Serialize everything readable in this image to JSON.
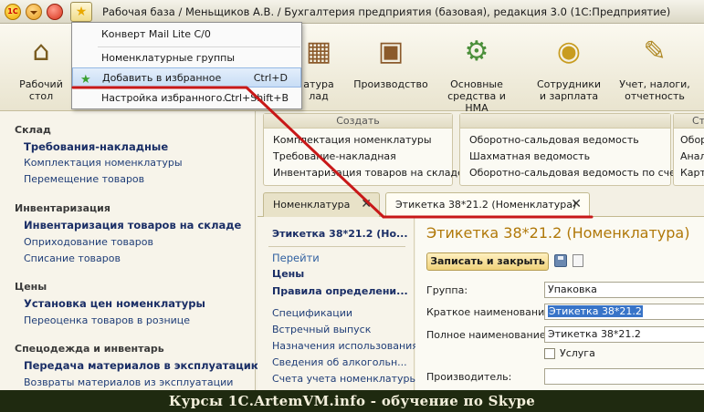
{
  "window": {
    "title": "Рабочая база / Меньщиков А.В. / Бухгалтерия предприятия (базовая), редакция 3.0  (1С:Предприятие)",
    "logo_text": "1С"
  },
  "toolbar": {
    "items": [
      {
        "label": "Рабочий стол",
        "icon": "home-icon"
      },
      {
        "label": "Номенклатура склад",
        "icon": "boxes-icon"
      },
      {
        "label": "Производство",
        "icon": "toolbox-icon"
      },
      {
        "label": "Основные средства и НМА",
        "icon": "gear-icon"
      },
      {
        "label": "Сотрудники и зарплата",
        "icon": "coins-icon"
      },
      {
        "label": "Учет, налоги, отчетность",
        "icon": "user-icon"
      }
    ],
    "partial_labels": [
      "атура",
      "лад"
    ]
  },
  "fav_menu": {
    "items": [
      {
        "label": "Конверт Mail Lite C/0",
        "shortcut": ""
      },
      {
        "label": "Номенклатурные группы",
        "shortcut": ""
      },
      {
        "label": "Добавить в избранное",
        "shortcut": "Ctrl+D",
        "highlighted": true
      },
      {
        "label": "Настройка избранного...",
        "shortcut": "Ctrl+Shift+B"
      }
    ]
  },
  "leftnav": {
    "groups": [
      {
        "title": "Склад",
        "items": [
          {
            "label": "Требования-накладные",
            "bold": true
          },
          {
            "label": "Комплектация номенклатуры"
          },
          {
            "label": "Перемещение товаров"
          }
        ]
      },
      {
        "title": "Инвентаризация",
        "items": [
          {
            "label": "Инвентаризация товаров на складе",
            "bold": true
          },
          {
            "label": "Оприходование товаров"
          },
          {
            "label": "Списание товаров"
          }
        ]
      },
      {
        "title": "Цены",
        "items": [
          {
            "label": "Установка цен номенклатуры",
            "bold": true
          },
          {
            "label": "Переоценка товаров в рознице"
          }
        ]
      },
      {
        "title": "Спецодежда и инвентарь",
        "items": [
          {
            "label": "Передача материалов в эксплуатацию",
            "bold": true
          },
          {
            "label": "Возвраты материалов из эксплуатации"
          }
        ]
      }
    ]
  },
  "panels": {
    "create": {
      "title": "Создать",
      "links": [
        "Комплектация номенклатуры",
        "Требование-накладная",
        "Инвентаризация товаров на складе"
      ]
    },
    "reports": {
      "title": "",
      "links": [
        "Оборотно-сальдовая ведомость",
        "Шахматная ведомость",
        "Оборотно-сальдовая ведомость по счету"
      ]
    },
    "third": {
      "title": "Ст",
      "links": [
        "Обор",
        "Анал",
        "Карт"
      ]
    }
  },
  "tabs": [
    {
      "label": "Номенклатура",
      "close": "✕"
    },
    {
      "label": "Этикетка 38*21.2 (Номенклатура)",
      "close": "✕",
      "active": true
    }
  ],
  "form_nav": {
    "title": "Этикетка 38*21.2 (Но...",
    "goto": "Перейти",
    "links_bold": [
      "Цены",
      "Правила определени..."
    ],
    "links": [
      "Спецификации",
      "Встречный выпуск",
      "Назначения использования",
      "Сведения об алкогольн...",
      "Счета учета номенклатуры"
    ]
  },
  "form": {
    "title": "Этикетка 38*21.2 (Номенклатура)",
    "save_button": "Записать и закрыть",
    "fields": [
      {
        "label": "Группа:",
        "value": "Упаковка"
      },
      {
        "label": "Краткое наименование:",
        "value": "Этикетка 38*21.2"
      },
      {
        "label": "Полное наименование:",
        "value": "Этикетка 38*21.2"
      },
      {
        "label": "Производитель:",
        "value": ""
      }
    ],
    "checkbox": "Услуга"
  },
  "banner": {
    "text": "Курсы 1С.ArtemVM.info - обучение по Skype"
  },
  "colors": {
    "accent": "#b07808",
    "annotation": "#c81818"
  }
}
